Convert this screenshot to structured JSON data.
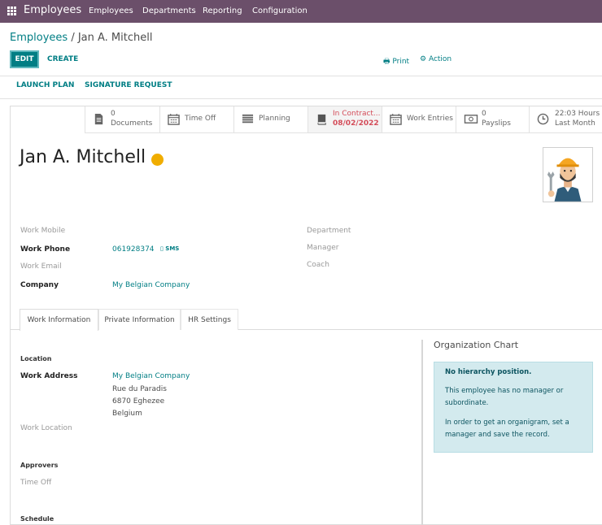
{
  "topbar": {
    "app_name": "Employees",
    "menu": [
      "Employees",
      "Departments",
      "Reporting",
      "Configuration"
    ]
  },
  "breadcrumb": {
    "parent": "Employees",
    "current": "Jan A. Mitchell"
  },
  "control": {
    "edit": "EDIT",
    "create": "CREATE",
    "print": "Print",
    "action": "Action"
  },
  "header_buttons": {
    "launch_plan": "LAUNCH PLAN",
    "signature_request": "SIGNATURE REQUEST"
  },
  "smart_buttons": {
    "documents": {
      "count": "0",
      "label": "Documents",
      "icon": "document-icon"
    },
    "time_off": {
      "label": "Time Off",
      "icon": "calendar-icon"
    },
    "planning": {
      "label": "Planning",
      "icon": "planning-icon"
    },
    "contract": {
      "line1": "In Contract...",
      "line2": "08/02/2022",
      "icon": "book-icon"
    },
    "work_entries": {
      "label": "Work Entries",
      "icon": "calendar-icon"
    },
    "payslips": {
      "count": "0",
      "label": "Payslips",
      "icon": "money-icon"
    },
    "hours": {
      "line1": "22:03 Hours",
      "line2": "Last Month",
      "icon": "clock-icon"
    }
  },
  "employee": {
    "name": "Jan A. Mitchell",
    "status_color": "#f0ad00"
  },
  "fields": {
    "work_mobile": {
      "label": "Work Mobile",
      "value": ""
    },
    "work_phone": {
      "label": "Work Phone",
      "value": "061928374",
      "sms": "SMS"
    },
    "work_email": {
      "label": "Work Email",
      "value": ""
    },
    "company": {
      "label": "Company",
      "value": "My Belgian Company"
    },
    "department": {
      "label": "Department",
      "value": ""
    },
    "manager": {
      "label": "Manager",
      "value": ""
    },
    "coach": {
      "label": "Coach",
      "value": ""
    }
  },
  "tabs": [
    "Work Information",
    "Private Information",
    "HR Settings"
  ],
  "work_info": {
    "location_section": "Location",
    "work_address_label": "Work Address",
    "work_address": [
      "My Belgian Company",
      "Rue du Paradis",
      "6870 Eghezee",
      "Belgium"
    ],
    "work_location_label": "Work Location",
    "approvers_section": "Approvers",
    "time_off_label": "Time Off",
    "schedule_section": "Schedule"
  },
  "org_chart": {
    "title": "Organization Chart",
    "heading": "No hierarchy position.",
    "line1": "This employee has no manager or",
    "line2": "subordinate.",
    "line3": "In order to get an organigram, set a",
    "line4": "manager and save the record."
  },
  "colors": {
    "brand": "#6b4f6a",
    "accent": "#017e84",
    "danger": "#d44c59",
    "info_bg": "#d3eaee"
  }
}
